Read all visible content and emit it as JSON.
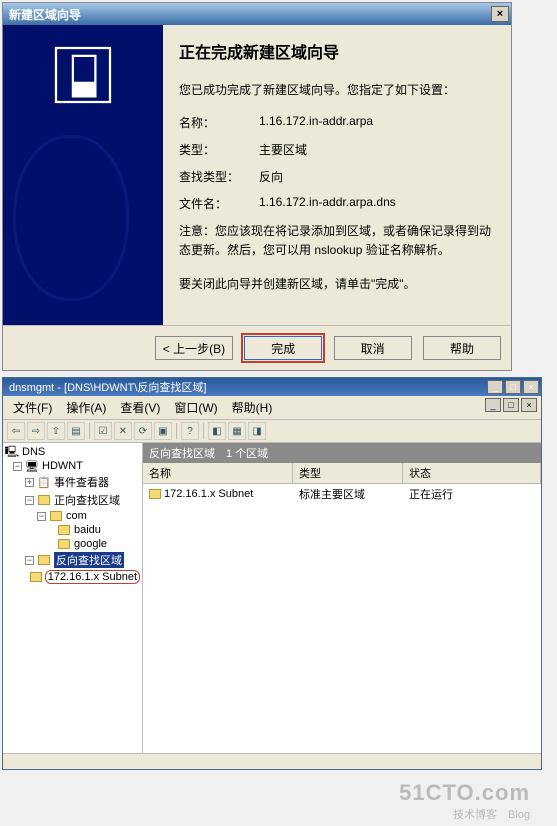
{
  "wizard": {
    "title": "新建区域向导",
    "close_glyph": "×",
    "heading": "正在完成新建区域向导",
    "intro": "您已成功完成了新建区域向导。您指定了如下设置：",
    "rows": [
      {
        "label": "名称：",
        "value": "1.16.172.in-addr.arpa"
      },
      {
        "label": "类型：",
        "value": "主要区域"
      },
      {
        "label": "查找类型：",
        "value": "反向"
      },
      {
        "label": "文件名：",
        "value": "1.16.172.in-addr.arpa.dns"
      }
    ],
    "note": "注意：您应该现在将记录添加到区域，或者确保记录得到动态更新。然后，您可以用 nslookup 验证名称解析。",
    "closing": "要关闭此向导并创建新区域，请单击\"完成\"。",
    "buttons": {
      "back": "< 上一步(B)",
      "finish": "完成",
      "cancel": "取消",
      "help": "帮助"
    }
  },
  "mmc": {
    "title": "dnsmgmt - [DNS\\HDWNT\\反向查找区域]",
    "min": "_",
    "max": "□",
    "close": "×",
    "menu": [
      "文件(F)",
      "操作(A)",
      "查看(V)",
      "窗口(W)",
      "帮助(H)"
    ],
    "tree": {
      "root": "DNS",
      "server": "HDWNT",
      "event": "事件查看器",
      "fwd": "正向查找区域",
      "com": "com",
      "baidu": "baidu",
      "google": "google",
      "rev": "反向查找区域",
      "subnet": "172.16.1.x Subnet"
    },
    "list": {
      "banner": "反向查找区域　1 个区域",
      "headers": [
        "名称",
        "类型",
        "状态"
      ],
      "rows": [
        {
          "name": "172.16.1.x Subnet",
          "type": "标准主要区域",
          "status": "正在运行"
        }
      ]
    }
  },
  "watermark": {
    "big": "51CTO.com",
    "small": "技术博客　Blog"
  }
}
